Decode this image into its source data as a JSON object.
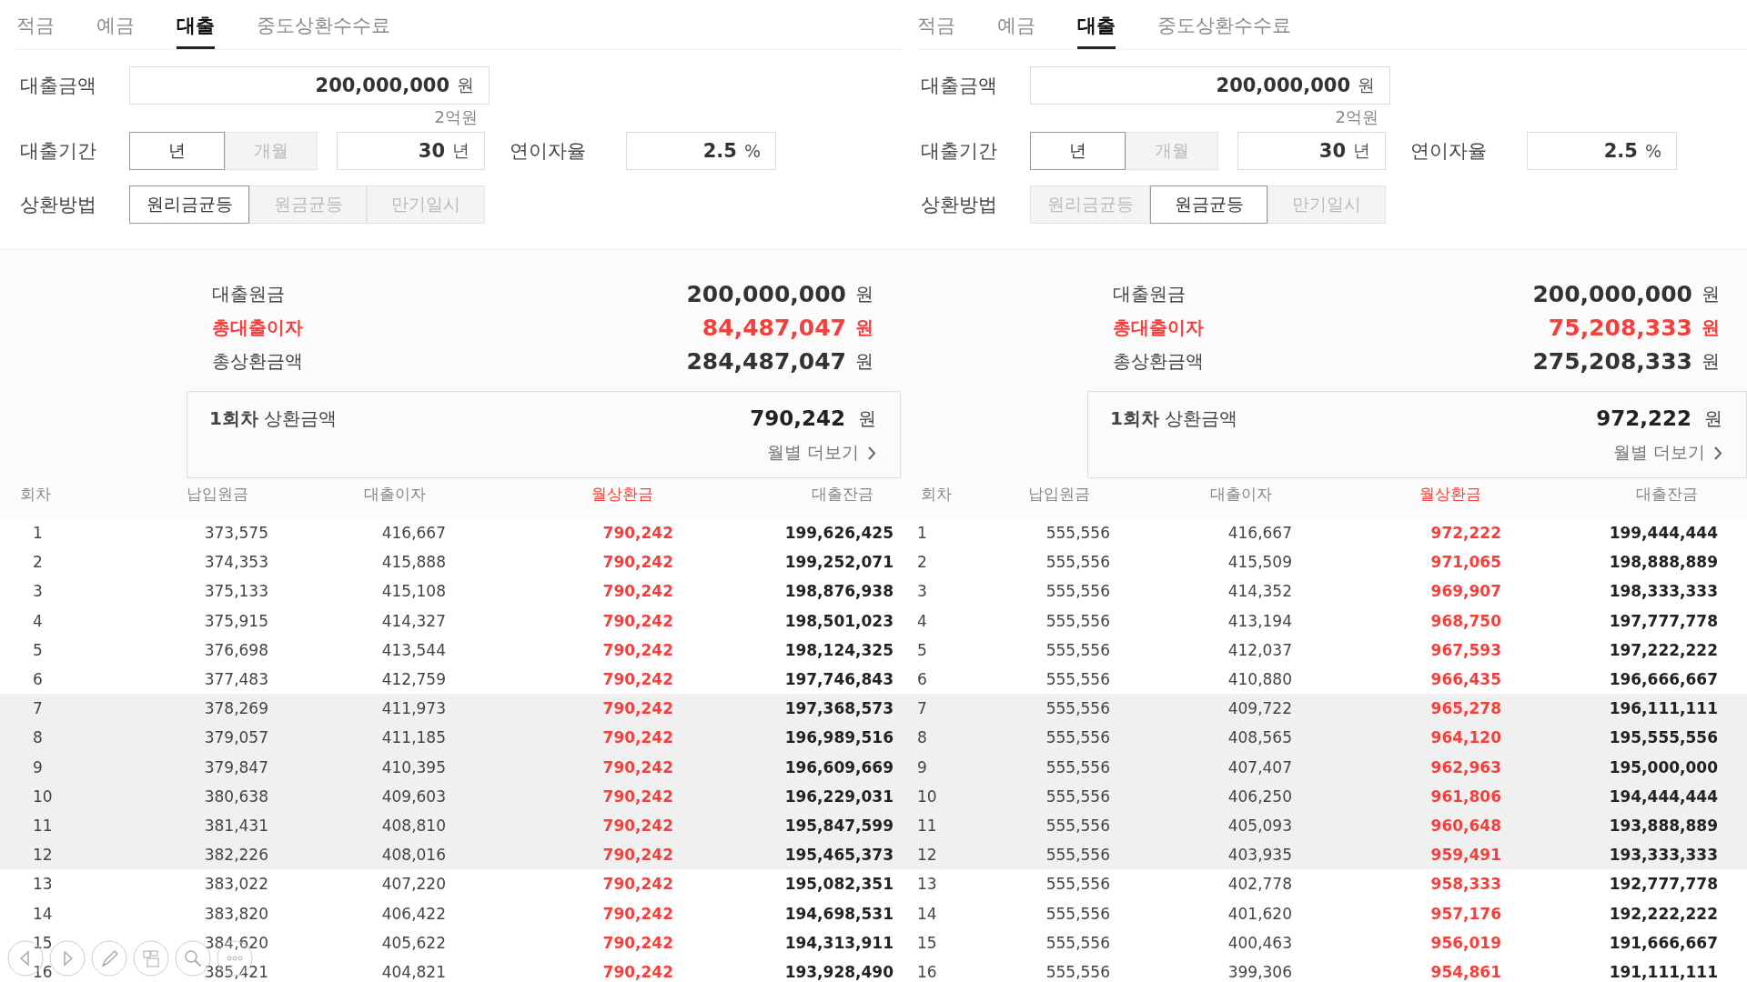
{
  "calculators": [
    {
      "tabs": [
        {
          "label": "적금",
          "selected": false
        },
        {
          "label": "예금",
          "selected": false
        },
        {
          "label": "대출",
          "selected": true
        },
        {
          "label": "중도상환수수료",
          "selected": false
        }
      ],
      "amount": {
        "label": "대출금액",
        "value": "200,000,000",
        "unit": "원",
        "hint": "2억원"
      },
      "period": {
        "label": "대출기간",
        "units": [
          {
            "label": "년",
            "selected": true
          },
          {
            "label": "개월",
            "selected": false
          }
        ],
        "value": "30",
        "unit": "년"
      },
      "rate": {
        "label": "연이자율",
        "value": "2.5",
        "unit": "%"
      },
      "method": {
        "label": "상환방법",
        "options": [
          {
            "label": "원리금균등",
            "selected": true
          },
          {
            "label": "원금균등",
            "selected": false
          },
          {
            "label": "만기일시",
            "selected": false
          }
        ]
      },
      "summary": [
        {
          "label": "대출원금",
          "value": "200,000,000",
          "unit": "원",
          "kind": "normal"
        },
        {
          "label": "총대출이자",
          "value": "84,487,047",
          "unit": "원",
          "kind": "highlight"
        },
        {
          "label": "총상환금액",
          "value": "284,487,047",
          "unit": "원",
          "kind": "normal"
        }
      ],
      "first_payment": {
        "label": "**1회차** 상환금액",
        "value": "790,242",
        "unit": "원",
        "more_link": "월별 더보기"
      },
      "table": {
        "columns": [
          {
            "label": "회차",
            "kind": "index"
          },
          {
            "label": "납입원금",
            "kind": "plain"
          },
          {
            "label": "대출이자",
            "kind": "plain"
          },
          {
            "label": "월상환금",
            "kind": "highlight"
          },
          {
            "label": "대출잔금",
            "kind": "strong"
          }
        ],
        "rows": [
          {
            "cells": [
              "1",
              "373,575",
              "416,667",
              "790,242",
              "199,626,425"
            ],
            "shaded": false
          },
          {
            "cells": [
              "2",
              "374,353",
              "415,888",
              "790,242",
              "199,252,071"
            ],
            "shaded": false
          },
          {
            "cells": [
              "3",
              "375,133",
              "415,108",
              "790,242",
              "198,876,938"
            ],
            "shaded": false
          },
          {
            "cells": [
              "4",
              "375,915",
              "414,327",
              "790,242",
              "198,501,023"
            ],
            "shaded": false
          },
          {
            "cells": [
              "5",
              "376,698",
              "413,544",
              "790,242",
              "198,124,325"
            ],
            "shaded": false
          },
          {
            "cells": [
              "6",
              "377,483",
              "412,759",
              "790,242",
              "197,746,843"
            ],
            "shaded": false
          },
          {
            "cells": [
              "7",
              "378,269",
              "411,973",
              "790,242",
              "197,368,573"
            ],
            "shaded": true
          },
          {
            "cells": [
              "8",
              "379,057",
              "411,185",
              "790,242",
              "196,989,516"
            ],
            "shaded": true
          },
          {
            "cells": [
              "9",
              "379,847",
              "410,395",
              "790,242",
              "196,609,669"
            ],
            "shaded": true
          },
          {
            "cells": [
              "10",
              "380,638",
              "409,603",
              "790,242",
              "196,229,031"
            ],
            "shaded": true
          },
          {
            "cells": [
              "11",
              "381,431",
              "408,810",
              "790,242",
              "195,847,599"
            ],
            "shaded": true
          },
          {
            "cells": [
              "12",
              "382,226",
              "408,016",
              "790,242",
              "195,465,373"
            ],
            "shaded": true
          },
          {
            "cells": [
              "13",
              "383,022",
              "407,220",
              "790,242",
              "195,082,351"
            ],
            "shaded": false
          },
          {
            "cells": [
              "14",
              "383,820",
              "406,422",
              "790,242",
              "194,698,531"
            ],
            "shaded": false
          },
          {
            "cells": [
              "15",
              "384,620",
              "405,622",
              "790,242",
              "194,313,911"
            ],
            "shaded": false
          },
          {
            "cells": [
              "16",
              "385,421",
              "404,821",
              "790,242",
              "193,928,490"
            ],
            "shaded": false
          }
        ]
      }
    },
    {
      "tabs": [
        {
          "label": "적금",
          "selected": false
        },
        {
          "label": "예금",
          "selected": false
        },
        {
          "label": "대출",
          "selected": true
        },
        {
          "label": "중도상환수수료",
          "selected": false
        }
      ],
      "amount": {
        "label": "대출금액",
        "value": "200,000,000",
        "unit": "원",
        "hint": "2억원"
      },
      "period": {
        "label": "대출기간",
        "units": [
          {
            "label": "년",
            "selected": true
          },
          {
            "label": "개월",
            "selected": false
          }
        ],
        "value": "30",
        "unit": "년"
      },
      "rate": {
        "label": "연이자율",
        "value": "2.5",
        "unit": "%"
      },
      "method": {
        "label": "상환방법",
        "options": [
          {
            "label": "원리금균등",
            "selected": false
          },
          {
            "label": "원금균등",
            "selected": true
          },
          {
            "label": "만기일시",
            "selected": false
          }
        ]
      },
      "summary": [
        {
          "label": "대출원금",
          "value": "200,000,000",
          "unit": "원",
          "kind": "normal"
        },
        {
          "label": "총대출이자",
          "value": "75,208,333",
          "unit": "원",
          "kind": "highlight"
        },
        {
          "label": "총상환금액",
          "value": "275,208,333",
          "unit": "원",
          "kind": "normal"
        }
      ],
      "first_payment": {
        "label": "**1회차** 상환금액",
        "value": "972,222",
        "unit": "원",
        "more_link": "월별 더보기"
      },
      "table": {
        "columns": [
          {
            "label": "회차",
            "kind": "index"
          },
          {
            "label": "납입원금",
            "kind": "plain"
          },
          {
            "label": "대출이자",
            "kind": "plain"
          },
          {
            "label": "월상환금",
            "kind": "highlight"
          },
          {
            "label": "대출잔금",
            "kind": "strong"
          }
        ],
        "rows": [
          {
            "cells": [
              "1",
              "555,556",
              "416,667",
              "972,222",
              "199,444,444"
            ],
            "shaded": false
          },
          {
            "cells": [
              "2",
              "555,556",
              "415,509",
              "971,065",
              "198,888,889"
            ],
            "shaded": false
          },
          {
            "cells": [
              "3",
              "555,556",
              "414,352",
              "969,907",
              "198,333,333"
            ],
            "shaded": false
          },
          {
            "cells": [
              "4",
              "555,556",
              "413,194",
              "968,750",
              "197,777,778"
            ],
            "shaded": false
          },
          {
            "cells": [
              "5",
              "555,556",
              "412,037",
              "967,593",
              "197,222,222"
            ],
            "shaded": false
          },
          {
            "cells": [
              "6",
              "555,556",
              "410,880",
              "966,435",
              "196,666,667"
            ],
            "shaded": false
          },
          {
            "cells": [
              "7",
              "555,556",
              "409,722",
              "965,278",
              "196,111,111"
            ],
            "shaded": true
          },
          {
            "cells": [
              "8",
              "555,556",
              "408,565",
              "964,120",
              "195,555,556"
            ],
            "shaded": true
          },
          {
            "cells": [
              "9",
              "555,556",
              "407,407",
              "962,963",
              "195,000,000"
            ],
            "shaded": true
          },
          {
            "cells": [
              "10",
              "555,556",
              "406,250",
              "961,806",
              "194,444,444"
            ],
            "shaded": true
          },
          {
            "cells": [
              "11",
              "555,556",
              "405,093",
              "960,648",
              "193,888,889"
            ],
            "shaded": true
          },
          {
            "cells": [
              "12",
              "555,556",
              "403,935",
              "959,491",
              "193,333,333"
            ],
            "shaded": true
          },
          {
            "cells": [
              "13",
              "555,556",
              "402,778",
              "958,333",
              "192,777,778"
            ],
            "shaded": false
          },
          {
            "cells": [
              "14",
              "555,556",
              "401,620",
              "957,176",
              "192,222,222"
            ],
            "shaded": false
          },
          {
            "cells": [
              "15",
              "555,556",
              "400,463",
              "956,019",
              "191,666,667"
            ],
            "shaded": false
          },
          {
            "cells": [
              "16",
              "555,556",
              "399,306",
              "954,861",
              "191,111,111"
            ],
            "shaded": false
          }
        ]
      }
    }
  ],
  "viewer_toolbar": [
    {
      "kind": "prev"
    },
    {
      "kind": "next"
    },
    {
      "kind": "pen"
    },
    {
      "kind": "pages"
    },
    {
      "kind": "zoom"
    },
    {
      "kind": "more"
    }
  ]
}
